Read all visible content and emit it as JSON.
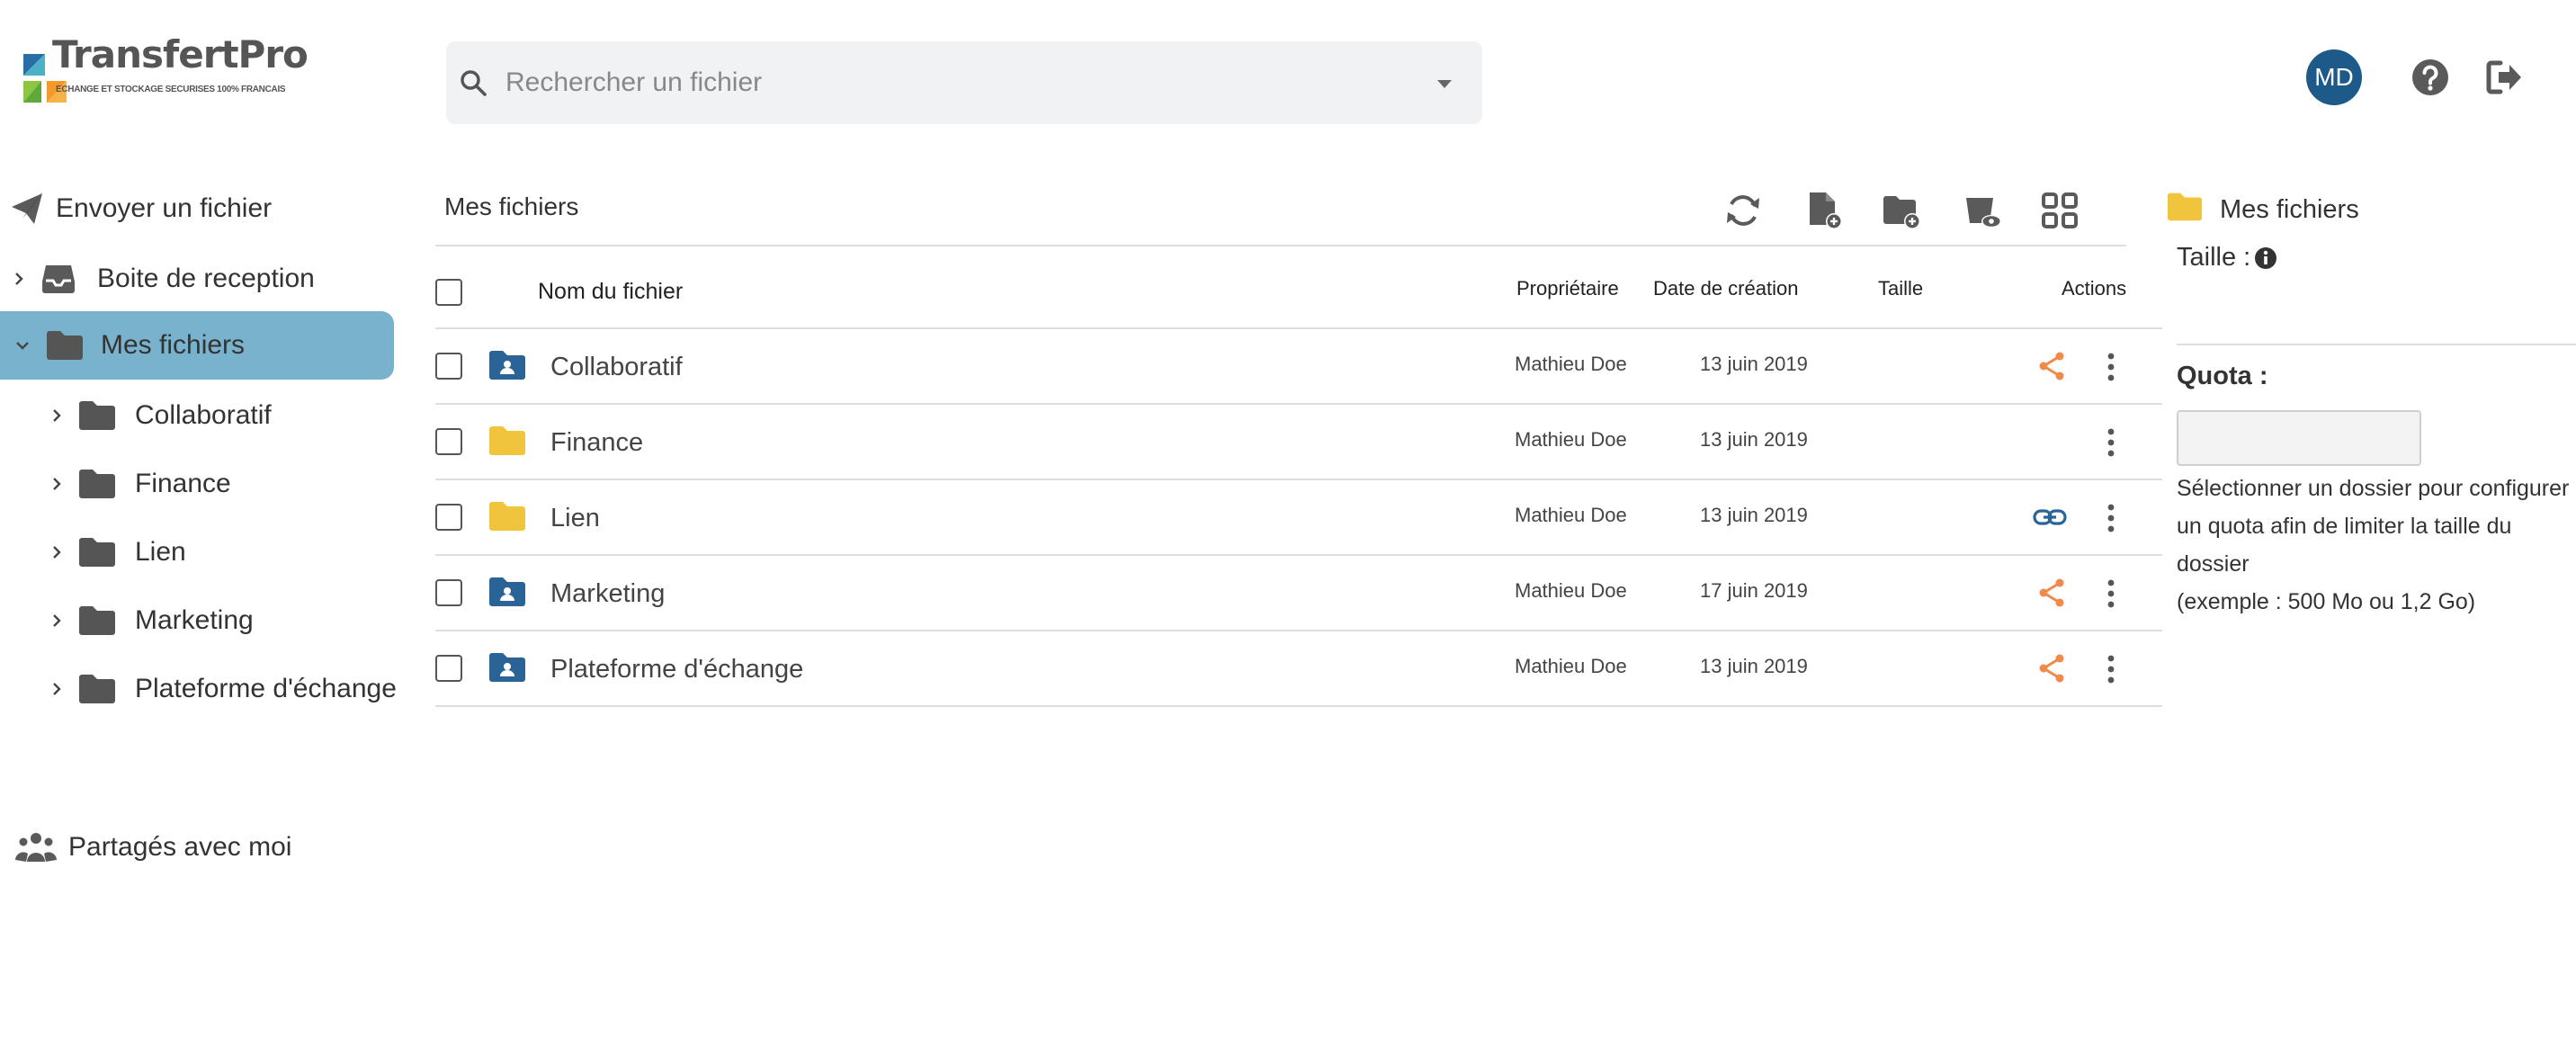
{
  "brand": {
    "name": "TransfertPro",
    "tagline": "ECHANGE ET STOCKAGE SECURISES 100% FRANCAIS",
    "colors": [
      "#2a6ea6",
      "#4bb0c8",
      "#8cc63f",
      "#f39a2b"
    ]
  },
  "search": {
    "placeholder": "Rechercher un fichier"
  },
  "user": {
    "initials": "MD"
  },
  "header_icons": [
    "help-icon",
    "logout-icon"
  ],
  "sidebar": {
    "send": "Envoyer un fichier",
    "inbox": "Boite de reception",
    "mine": "Mes fichiers",
    "subfolders": [
      "Collaboratif",
      "Finance",
      "Lien",
      "Marketing",
      "Plateforme d'échange"
    ],
    "shared": "Partagés avec moi"
  },
  "main": {
    "breadcrumb": "Mes fichiers",
    "toolbar": [
      "refresh-icon",
      "new-file-icon",
      "new-folder-icon",
      "preview-icon",
      "grid-view-icon"
    ],
    "columns": {
      "name": "Nom du fichier",
      "owner": "Propriétaire",
      "created": "Date de création",
      "size": "Taille",
      "actions": "Actions"
    },
    "rows": [
      {
        "name": "Collaboratif",
        "owner": "Mathieu Doe",
        "date": "13 juin 2019",
        "folder": "shared",
        "action": "share"
      },
      {
        "name": "Finance",
        "owner": "Mathieu Doe",
        "date": "13 juin 2019",
        "folder": "plain",
        "action": "none"
      },
      {
        "name": "Lien",
        "owner": "Mathieu Doe",
        "date": "13 juin 2019",
        "folder": "plain",
        "action": "link"
      },
      {
        "name": "Marketing",
        "owner": "Mathieu Doe",
        "date": "17 juin 2019",
        "folder": "shared",
        "action": "share"
      },
      {
        "name": "Plateforme d'échange",
        "owner": "Mathieu Doe",
        "date": "13 juin 2019",
        "folder": "shared",
        "action": "share"
      }
    ]
  },
  "panel": {
    "title": "Mes fichiers",
    "size_label": "Taille :",
    "quota_label": "Quota :",
    "quota_value": "",
    "help": "Sélectionner un dossier pour configurer un quota afin de limiter la taille du dossier",
    "example": "(exemple : 500 Mo ou 1,2 Go)"
  },
  "colors": {
    "accent": "#79b2cc",
    "avatar": "#1d5a8a",
    "shared_folder": "#2a6496",
    "plain_folder": "#f0c43c",
    "share": "#f08a4b",
    "link": "#2a6496",
    "icon_grey": "#555555"
  }
}
